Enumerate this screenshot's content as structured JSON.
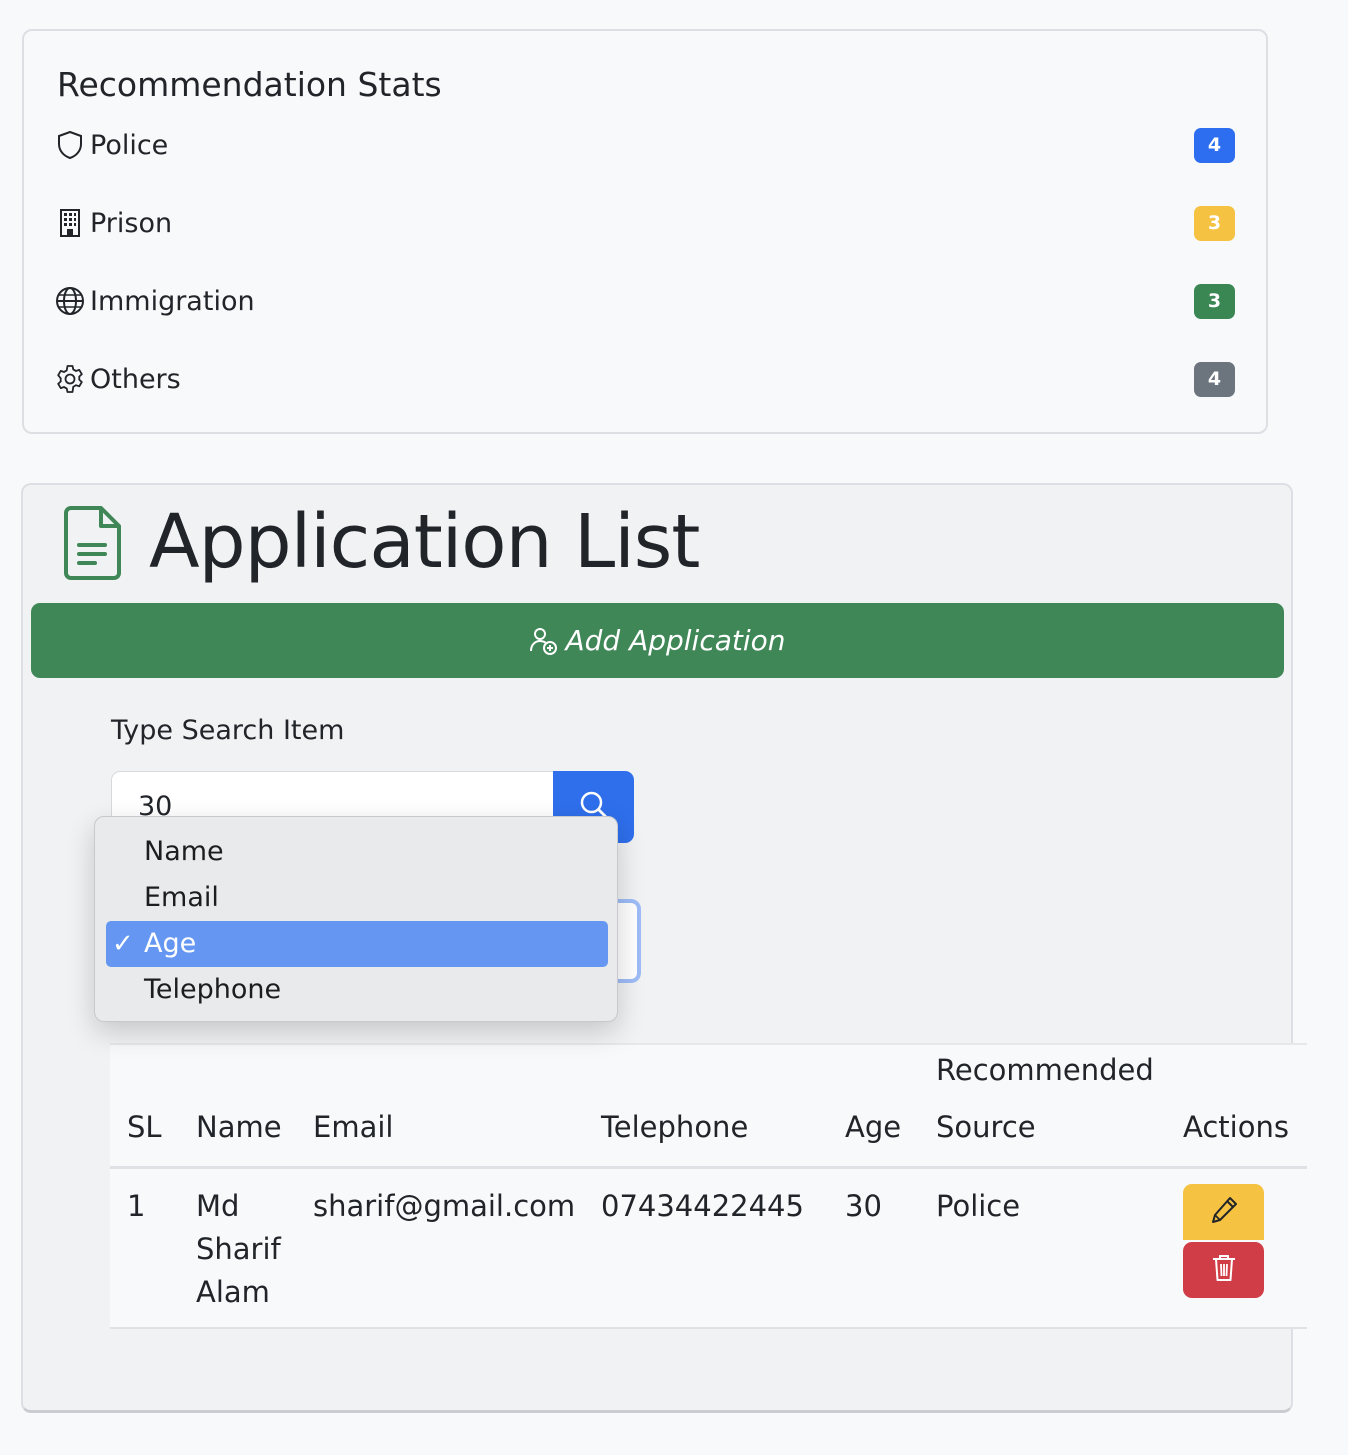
{
  "stats": {
    "title": "Recommendation Stats",
    "items": [
      {
        "label": "Police",
        "count": "4",
        "icon": "shield-icon",
        "color": "#2d6ef0"
      },
      {
        "label": "Prison",
        "count": "3",
        "icon": "building-icon",
        "color": "#f5c242"
      },
      {
        "label": "Immigration",
        "count": "3",
        "icon": "globe-icon",
        "color": "#3b8754"
      },
      {
        "label": "Others",
        "count": "4",
        "icon": "gear-icon",
        "color": "#6c747d"
      }
    ]
  },
  "app": {
    "title": "Application List",
    "title_icon": "document-icon",
    "add_button": "Add Application",
    "add_icon": "person-plus-icon",
    "accent": "#408757"
  },
  "search": {
    "label": "Type Search Item",
    "value": "30",
    "button_icon": "search-icon",
    "options": [
      "Name",
      "Email",
      "Age",
      "Telephone"
    ],
    "selected": "Age"
  },
  "table": {
    "headers": {
      "sl": "SL",
      "name": "Name",
      "email": "Email",
      "telephone": "Telephone",
      "age": "Age",
      "source_line1": "Recommended",
      "source_line2": "Source",
      "actions": "Actions"
    },
    "rows": [
      {
        "sl": "1",
        "name_line1": "Md",
        "name_line2": "Sharif",
        "name_line3": "Alam",
        "email": "sharif@gmail.com",
        "telephone": "07434422445",
        "age": "30",
        "source": "Police",
        "edit_icon": "pencil-icon",
        "delete_icon": "trash-icon"
      }
    ]
  }
}
